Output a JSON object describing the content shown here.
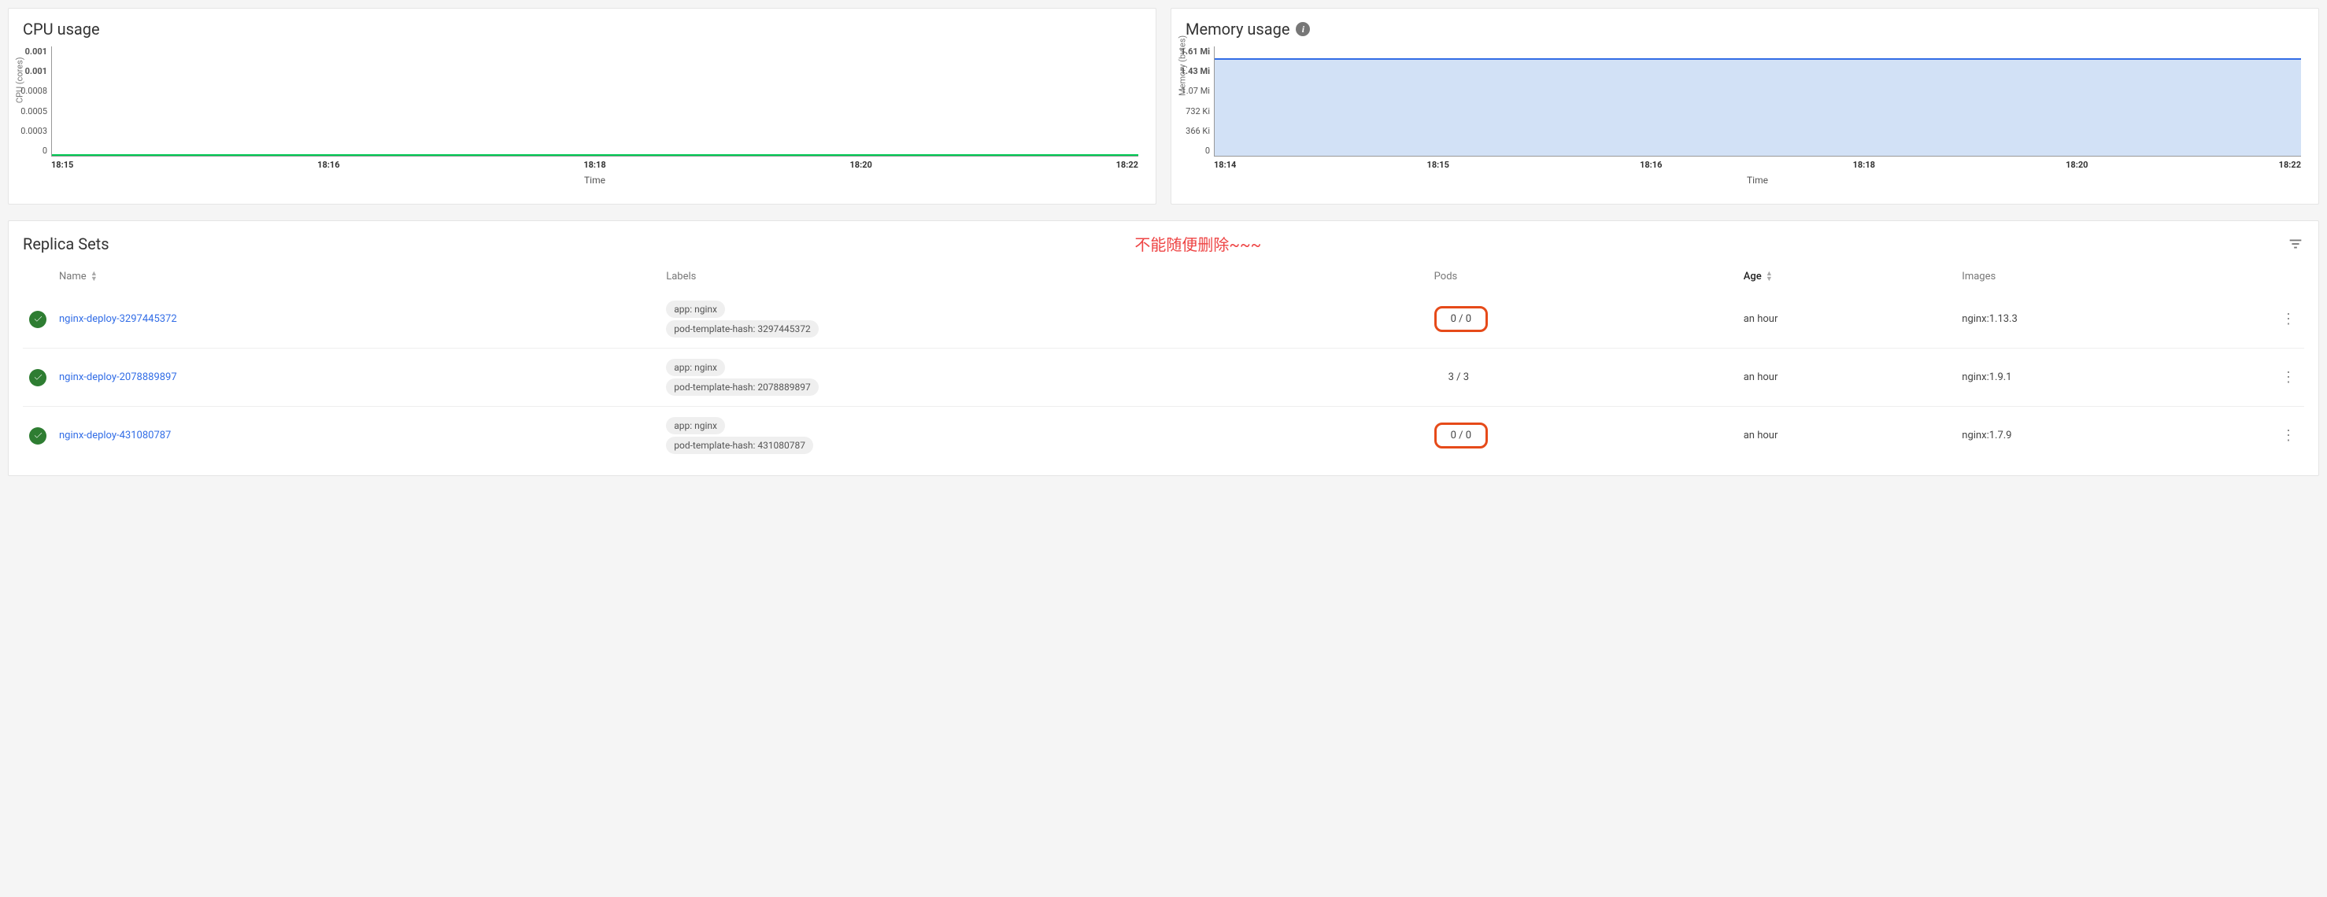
{
  "cpu_card": {
    "title": "CPU usage",
    "ylabel": "CPU (cores)",
    "xlabel": "Time"
  },
  "mem_card": {
    "title": "Memory usage",
    "ylabel": "Memory (bytes)",
    "xlabel": "Time"
  },
  "chart_data": [
    {
      "id": "cpu",
      "type": "line",
      "title": "CPU usage",
      "ylabel": "CPU (cores)",
      "xlabel": "Time",
      "ylim": [
        0,
        0.001
      ],
      "yticks": [
        "0.001",
        "0.001",
        "0.0008",
        "0.0005",
        "0.0003",
        "0"
      ],
      "categories": [
        "18:15",
        "18:16",
        "18:18",
        "18:20",
        "18:22"
      ],
      "values": [
        0,
        0,
        0,
        0,
        0
      ],
      "line_color": "#00c853"
    },
    {
      "id": "memory",
      "type": "area",
      "title": "Memory usage",
      "ylabel": "Memory (bytes)",
      "xlabel": "Time",
      "ylim": [
        0,
        "1.61 Mi"
      ],
      "yticks": [
        "1.61 Mi",
        "1.43 Mi",
        "1.07 Mi",
        "732 Ki",
        "366 Ki",
        "0"
      ],
      "categories": [
        "18:14",
        "18:15",
        "18:16",
        "18:18",
        "18:20",
        "18:22"
      ],
      "values": [
        "1.43 Mi",
        "1.43 Mi",
        "1.43 Mi",
        "1.43 Mi",
        "1.43 Mi",
        "1.43 Mi"
      ],
      "line_color": "#326de6",
      "fill_color": "#d2e1f6"
    }
  ],
  "panel": {
    "title": "Replica Sets",
    "annotation": "不能随便删除~~~",
    "columns": {
      "name": "Name",
      "labels": "Labels",
      "pods": "Pods",
      "age": "Age",
      "images": "Images"
    }
  },
  "rows": [
    {
      "status": "ok",
      "name": "nginx-deploy-3297445372",
      "labels": [
        "app: nginx",
        "pod-template-hash: 3297445372"
      ],
      "pods": "0 / 0",
      "pods_boxed": true,
      "age": "an hour",
      "images": "nginx:1.13.3"
    },
    {
      "status": "ok",
      "name": "nginx-deploy-2078889897",
      "labels": [
        "app: nginx",
        "pod-template-hash: 2078889897"
      ],
      "pods": "3 / 3",
      "pods_boxed": false,
      "age": "an hour",
      "images": "nginx:1.9.1"
    },
    {
      "status": "ok",
      "name": "nginx-deploy-431080787",
      "labels": [
        "app: nginx",
        "pod-template-hash: 431080787"
      ],
      "pods": "0 / 0",
      "pods_boxed": true,
      "age": "an hour",
      "images": "nginx:1.7.9"
    }
  ]
}
